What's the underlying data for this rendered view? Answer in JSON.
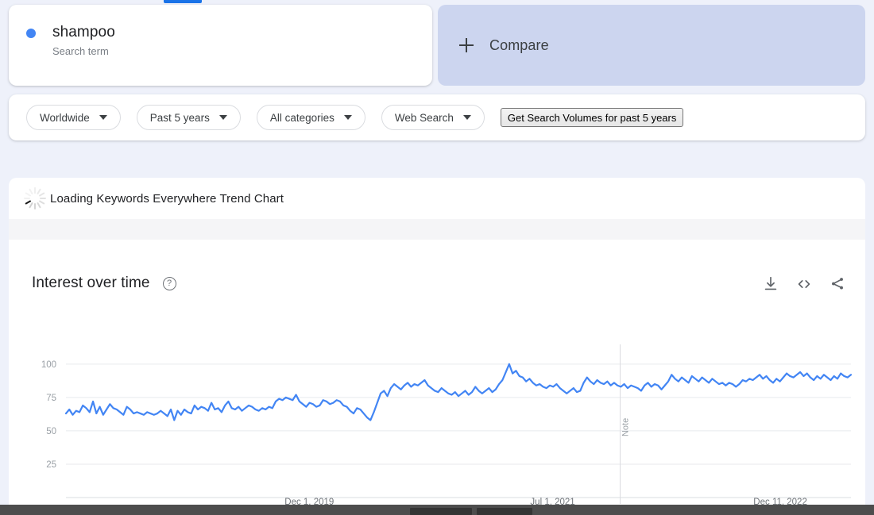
{
  "search_term": {
    "label": "shampoo",
    "subtitle": "Search term",
    "dot_color": "#4285f4"
  },
  "compare": {
    "label": "Compare",
    "plus_icon": "plus-icon",
    "panel_color": "#ccd5ef"
  },
  "filters": {
    "chips": [
      {
        "label": "Worldwide",
        "icon": "chevron-down-icon"
      },
      {
        "label": "Past 5 years",
        "icon": "chevron-down-icon"
      },
      {
        "label": "All categories",
        "icon": "chevron-down-icon"
      },
      {
        "label": "Web Search",
        "icon": "chevron-down-icon"
      }
    ],
    "action_button": "Get Search Volumes for past 5 years"
  },
  "loading": {
    "text": "Loading Keywords Everywhere Trend Chart",
    "icon": "spinner-icon"
  },
  "chart_panel": {
    "title": "Interest over time",
    "help_icon": "help-circle-icon",
    "actions": [
      {
        "name": "download-icon",
        "label": "Download"
      },
      {
        "name": "embed-code-icon",
        "label": "Embed"
      },
      {
        "name": "share-icon",
        "label": "Share"
      }
    ]
  },
  "chart_data": {
    "type": "line",
    "title": "Interest over time",
    "xlabel": "",
    "ylabel": "",
    "ylim": [
      0,
      110
    ],
    "yticks": [
      100,
      75,
      50,
      25
    ],
    "grid": true,
    "legend_position": "none",
    "line_color": "#4285f4",
    "annotations": [
      {
        "type": "vertical-line",
        "label": "Note",
        "x_fraction": 0.706
      }
    ],
    "xticks": [
      "Dec 1, 2019",
      "Jul 1, 2021",
      "Dec 11, 2022"
    ],
    "xtick_fractions": [
      0.31,
      0.62,
      0.91
    ],
    "series": [
      {
        "name": "shampoo",
        "values": [
          63,
          66,
          62,
          65,
          64,
          69,
          67,
          64,
          72,
          63,
          68,
          62,
          66,
          70,
          67,
          66,
          64,
          62,
          68,
          66,
          63,
          64,
          63,
          62,
          64,
          63,
          62,
          63,
          65,
          63,
          61,
          66,
          58,
          65,
          62,
          66,
          64,
          63,
          69,
          66,
          68,
          67,
          65,
          71,
          66,
          67,
          64,
          69,
          72,
          67,
          66,
          68,
          65,
          67,
          69,
          68,
          66,
          65,
          67,
          66,
          68,
          67,
          72,
          74,
          73,
          75,
          74,
          73,
          77,
          72,
          70,
          68,
          71,
          70,
          68,
          69,
          73,
          72,
          70,
          71,
          73,
          72,
          69,
          68,
          65,
          63,
          67,
          66,
          63,
          60,
          58,
          64,
          71,
          78,
          80,
          76,
          82,
          85,
          83,
          81,
          84,
          86,
          83,
          85,
          84,
          86,
          88,
          84,
          82,
          80,
          79,
          82,
          80,
          78,
          77,
          79,
          76,
          78,
          80,
          77,
          79,
          83,
          80,
          78,
          80,
          82,
          79,
          81,
          85,
          88,
          94,
          100,
          93,
          95,
          91,
          90,
          87,
          89,
          86,
          84,
          85,
          83,
          82,
          84,
          83,
          85,
          82,
          80,
          78,
          80,
          82,
          79,
          80,
          86,
          90,
          87,
          85,
          88,
          86,
          85,
          87,
          84,
          86,
          84,
          83,
          85,
          82,
          84,
          83,
          82,
          80,
          84,
          86,
          83,
          85,
          84,
          81,
          84,
          87,
          92,
          89,
          87,
          90,
          88,
          86,
          91,
          89,
          87,
          90,
          88,
          86,
          89,
          87,
          85,
          86,
          84,
          86,
          85,
          83,
          85,
          88,
          87,
          89,
          88,
          90,
          92,
          89,
          91,
          88,
          86,
          89,
          87,
          90,
          93,
          91,
          90,
          92,
          94,
          91,
          93,
          90,
          88,
          91,
          89,
          92,
          90,
          88,
          91,
          89,
          93,
          91,
          90,
          92
        ]
      }
    ]
  },
  "taskbar": {
    "items": [
      "window-a",
      "window-b"
    ]
  }
}
